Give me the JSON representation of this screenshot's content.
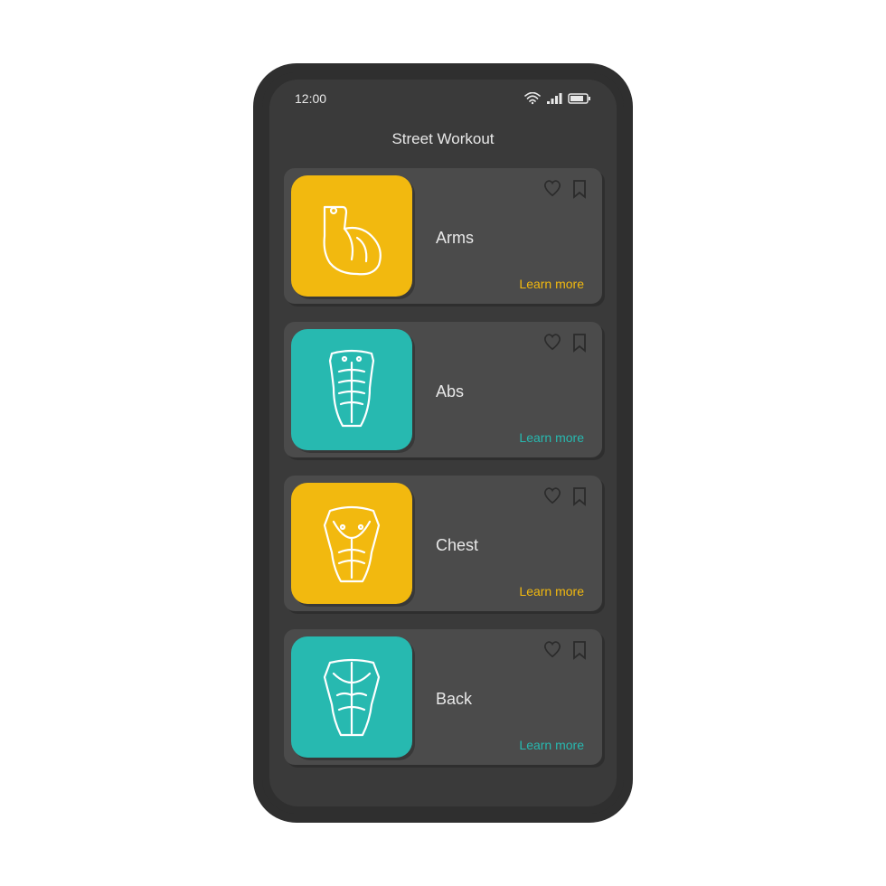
{
  "status": {
    "time": "12:00"
  },
  "header": {
    "title": "Street Workout"
  },
  "colors": {
    "yellow": "#f2b90f",
    "teal": "#27b9b0"
  },
  "cards": [
    {
      "title": "Arms",
      "learn": "Learn more",
      "icon": "bicep-icon",
      "color": "yellow"
    },
    {
      "title": "Abs",
      "learn": "Learn more",
      "icon": "abs-icon",
      "color": "teal"
    },
    {
      "title": "Chest",
      "learn": "Learn more",
      "icon": "chest-icon",
      "color": "yellow"
    },
    {
      "title": "Back",
      "learn": "Learn more",
      "icon": "back-icon",
      "color": "teal"
    }
  ]
}
